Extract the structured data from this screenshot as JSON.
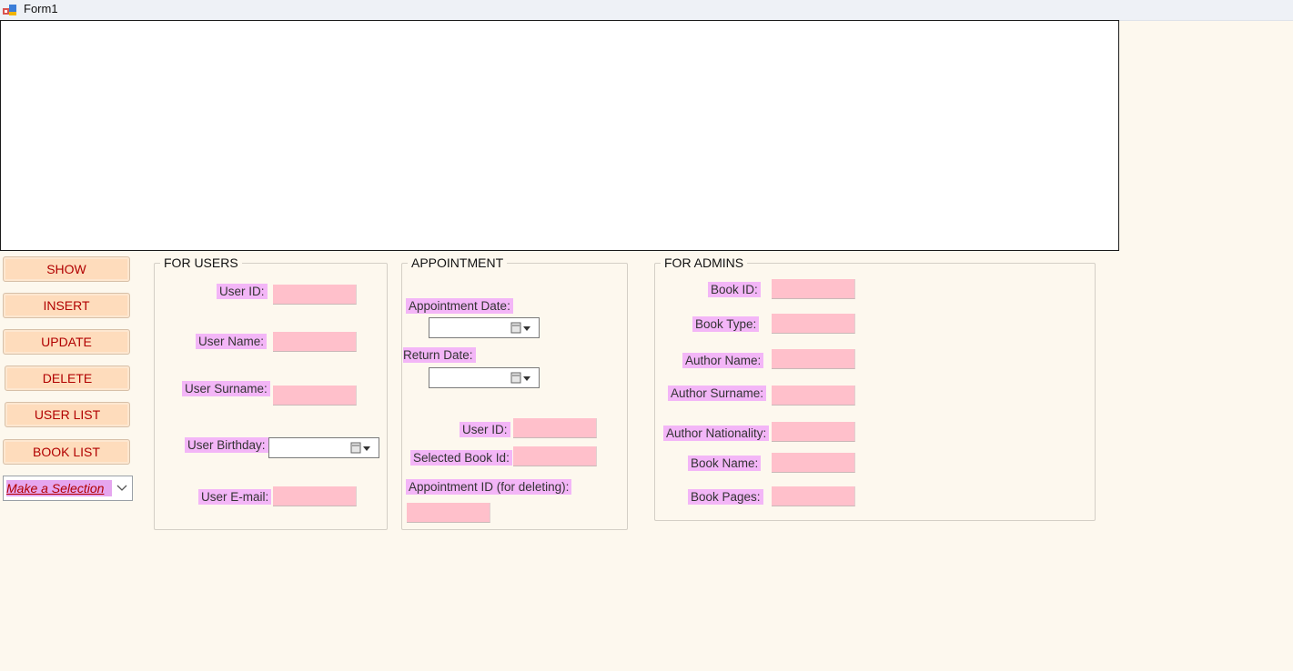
{
  "window": {
    "title": "Form1"
  },
  "buttons": {
    "show": "SHOW",
    "insert": "INSERT",
    "update": "UPDATE",
    "delete": "DELETE",
    "user_list": "USER LIST",
    "book_list": "BOOK LIST"
  },
  "selection": {
    "value": "Make a Selection"
  },
  "users": {
    "title": "FOR USERS",
    "user_id": "User ID:",
    "user_name": "User Name:",
    "user_surname": "User Surname:",
    "user_birthday": "User Birthday:",
    "user_email": "User E-mail:"
  },
  "appointment": {
    "title": "APPOINTMENT",
    "appointment_date": "Appointment Date:",
    "return_date": "Return Date:",
    "user_id": "User ID:",
    "selected_book_id": "Selected Book Id:",
    "appointment_id": "Appointment ID (for deleting):"
  },
  "admins": {
    "title": "FOR ADMINS",
    "book_id": "Book ID:",
    "book_type": "Book Type:",
    "author_name": "Author Name:",
    "author_surname": "Author Surname:",
    "author_nationality": "Author Nationality:",
    "book_name": "Book Name:",
    "book_pages": "Book Pages:"
  },
  "colors": {
    "form_bg": "#fdf8ee",
    "button_bg": "#fedcbc",
    "button_text": "#b10000",
    "label_bg": "#f3b6f7",
    "textbox_bg": "#ffc0cb"
  }
}
